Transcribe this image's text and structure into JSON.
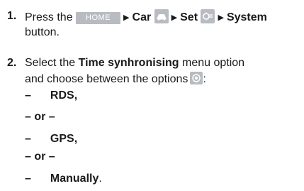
{
  "step1": {
    "number": "1.",
    "text_press": "Press the",
    "home_button": "HOME",
    "car": "Car",
    "set": "Set",
    "system": "System",
    "text_button": "button."
  },
  "step2": {
    "number": "2.",
    "text_select": "Select the",
    "menu_option": "Time synhronising",
    "text_menu": "menu option",
    "text_choose": "and choose between the options",
    "colon": ":"
  },
  "options": [
    {
      "dash": "–",
      "label": "RDS",
      "punct": ","
    },
    {
      "separator": "– or –"
    },
    {
      "dash": "–",
      "label": "GPS",
      "punct": ","
    },
    {
      "separator": "– or –"
    },
    {
      "dash": "–",
      "label": "Manually",
      "punct": "."
    }
  ],
  "icons": {
    "car": "car-icon",
    "set": "settings-icon",
    "select": "radio-select-icon"
  }
}
